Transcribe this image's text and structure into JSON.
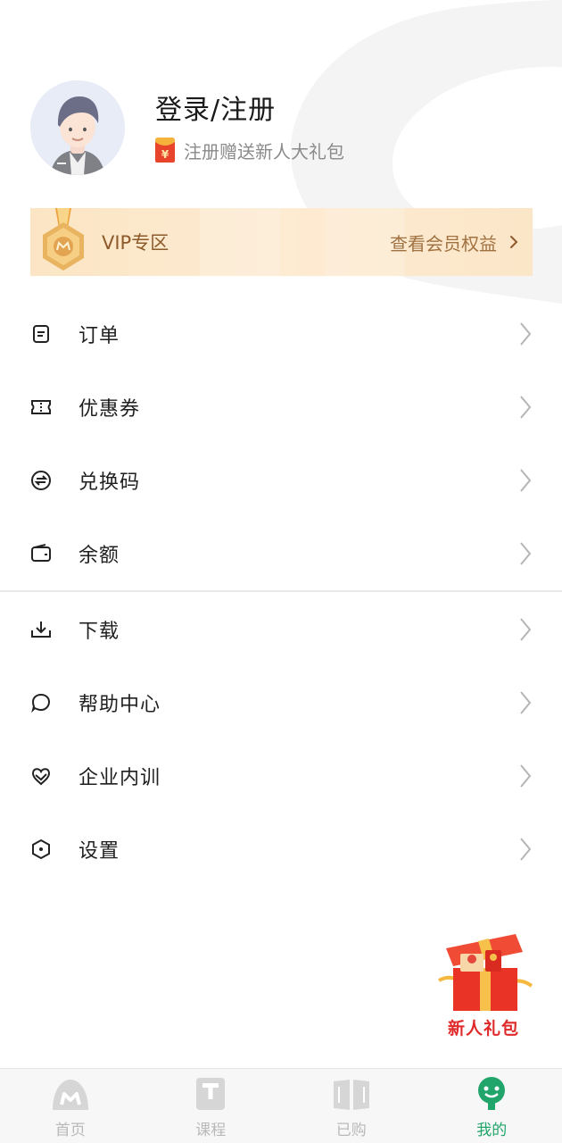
{
  "profile": {
    "login_title": "登录/注册",
    "gift_text": "注册赠送新人大礼包"
  },
  "vip": {
    "label": "VIP专区",
    "benefit_link": "查看会员权益"
  },
  "menu_group_1": [
    {
      "label": "订单",
      "icon": "order-icon"
    },
    {
      "label": "优惠券",
      "icon": "coupon-icon"
    },
    {
      "label": "兑换码",
      "icon": "exchange-code-icon"
    },
    {
      "label": "余额",
      "icon": "wallet-icon"
    }
  ],
  "menu_group_2": [
    {
      "label": "下载",
      "icon": "download-icon"
    },
    {
      "label": "帮助中心",
      "icon": "help-icon"
    },
    {
      "label": "企业内训",
      "icon": "enterprise-icon"
    },
    {
      "label": "设置",
      "icon": "settings-icon"
    }
  ],
  "float_gift": {
    "caption": "新人礼包"
  },
  "tabbar": {
    "tabs": [
      {
        "label": "首页",
        "icon": "home-icon",
        "active": false
      },
      {
        "label": "课程",
        "icon": "course-icon",
        "active": false
      },
      {
        "label": "已购",
        "icon": "purchased-book-icon",
        "active": false
      },
      {
        "label": "我的",
        "icon": "profile-icon",
        "active": true
      }
    ]
  },
  "colors": {
    "accent": "#22a56b",
    "vip_text": "#8c5a2b",
    "vip_bg": "#fbe5c4",
    "gift_red": "#e02a2a"
  }
}
